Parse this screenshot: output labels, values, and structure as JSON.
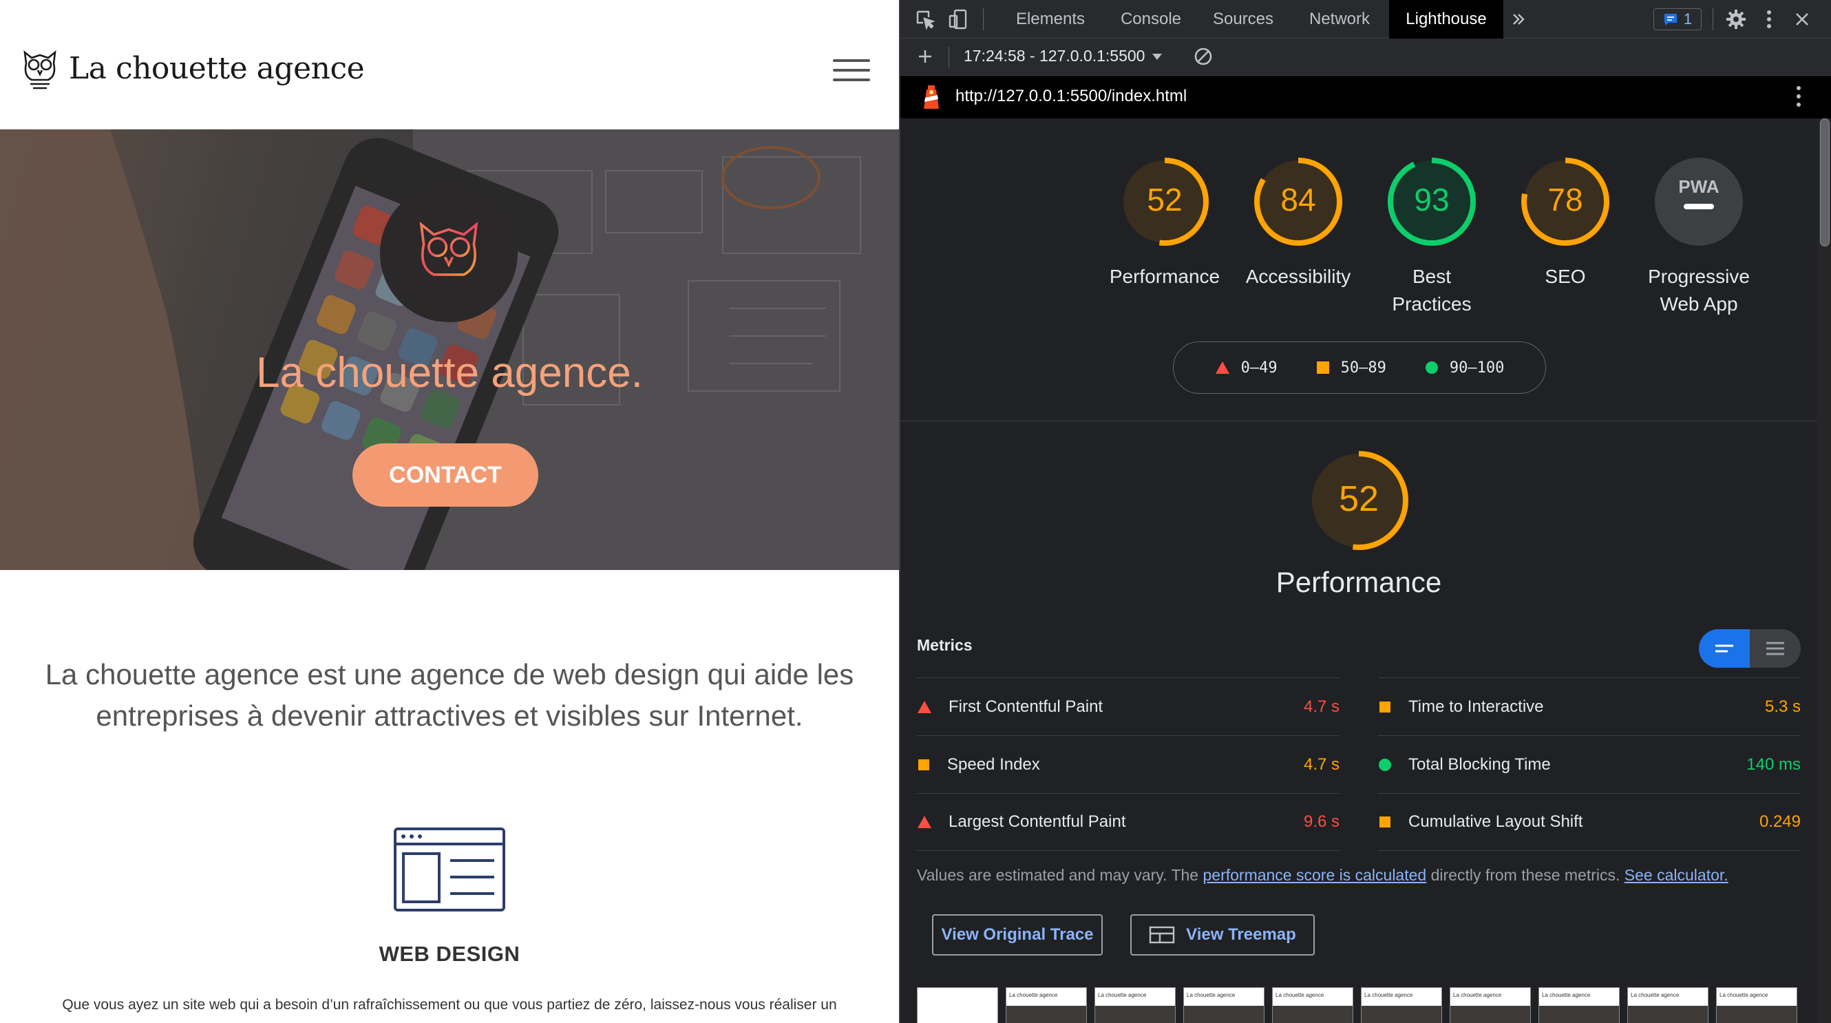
{
  "site": {
    "logo_text": "La chouette agence",
    "hero_title": "La chouette agence.",
    "contact_label": "CONTACT",
    "intro_text": "La chouette agence est une agence de web design qui aide les entreprises à devenir attractives et visibles sur Internet.",
    "service_title": "WEB DESIGN",
    "service_desc": "Que vous ayez un site web qui a besoin d’un rafraîchissement ou que vous partiez de zéro, laissez-nous vous réaliser un"
  },
  "devtools": {
    "tabs": [
      "Elements",
      "Console",
      "Sources",
      "Network",
      "Lighthouse"
    ],
    "active_tab": "Lighthouse",
    "more_tabs_icon": "chevron-double-right-icon",
    "issues_count": "1",
    "report_select": "17:24:58 - 127.0.0.1:5500",
    "url": "http://127.0.0.1:5500/index.html"
  },
  "lighthouse": {
    "categories": [
      {
        "label": "Performance",
        "score": "52",
        "color": "#ffa400"
      },
      {
        "label": "Accessibility",
        "score": "84",
        "color": "#ffa400"
      },
      {
        "label": "Best Practices",
        "score": "93",
        "color": "#0cce6b"
      },
      {
        "label": "SEO",
        "score": "78",
        "color": "#ffa400"
      },
      {
        "label": "Progressive Web App",
        "score": "PWA",
        "color": "#9aa0a6"
      }
    ],
    "legend": [
      {
        "range": "0–49",
        "shape": "triangle",
        "color": "#ff4e42"
      },
      {
        "range": "50–89",
        "shape": "square",
        "color": "#ffa400"
      },
      {
        "range": "90–100",
        "shape": "circle",
        "color": "#0cce6b"
      }
    ],
    "perf_score": "52",
    "perf_title": "Performance",
    "metrics_title": "Metrics",
    "metrics": [
      {
        "name": "First Contentful Paint",
        "value": "4.7 s",
        "rating": "fail",
        "color": "#ff4e42"
      },
      {
        "name": "Time to Interactive",
        "value": "5.3 s",
        "rating": "average",
        "color": "#ffa400"
      },
      {
        "name": "Speed Index",
        "value": "4.7 s",
        "rating": "average",
        "color": "#ffa400"
      },
      {
        "name": "Total Blocking Time",
        "value": "140 ms",
        "rating": "pass",
        "color": "#0cce6b"
      },
      {
        "name": "Largest Contentful Paint",
        "value": "9.6 s",
        "rating": "fail",
        "color": "#ff4e42"
      },
      {
        "name": "Cumulative Layout Shift",
        "value": "0.249",
        "rating": "average",
        "color": "#ffa400"
      }
    ],
    "note_prefix": "Values are estimated and may vary. The ",
    "note_link1": "performance score is calculated",
    "note_middle": " directly from these metrics. ",
    "note_link2": "See calculator.",
    "btn_trace": "View Original Trace",
    "btn_treemap": "View Treemap",
    "thumb_text": "La chouette agence"
  }
}
